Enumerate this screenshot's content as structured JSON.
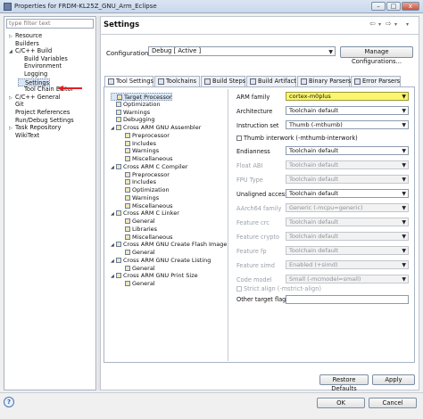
{
  "window": {
    "title": "Properties for FRDM-KL25Z_GNU_Arm_Eclipse",
    "minimize": "–",
    "maximize": "□",
    "close": "x"
  },
  "left": {
    "filter_placeholder": "type filter text",
    "items": [
      {
        "label": "Resource",
        "twisty": "▷",
        "indent": 0
      },
      {
        "label": "Builders",
        "twisty": "",
        "indent": 0
      },
      {
        "label": "C/C++ Build",
        "twisty": "◢",
        "indent": 0
      },
      {
        "label": "Build Variables",
        "twisty": "",
        "indent": 1
      },
      {
        "label": "Environment",
        "twisty": "",
        "indent": 1
      },
      {
        "label": "Logging",
        "twisty": "",
        "indent": 1
      },
      {
        "label": "Settings",
        "twisty": "",
        "indent": 1
      },
      {
        "label": "Tool Chain Editor",
        "twisty": "",
        "indent": 1
      },
      {
        "label": "C/C++ General",
        "twisty": "▷",
        "indent": 0
      },
      {
        "label": "Git",
        "twisty": "",
        "indent": 0
      },
      {
        "label": "Project References",
        "twisty": "",
        "indent": 0
      },
      {
        "label": "Run/Debug Settings",
        "twisty": "",
        "indent": 0
      },
      {
        "label": "Task Repository",
        "twisty": "▷",
        "indent": 0
      },
      {
        "label": "WikiText",
        "twisty": "",
        "indent": 0
      }
    ]
  },
  "header": {
    "title": "Settings",
    "back": "⇦",
    "back_menu": "▾",
    "forward": "⇨",
    "forward_menu": "▾",
    "view_menu": "▾"
  },
  "config": {
    "label": "Configuration:",
    "value": "Debug  [ Active ]",
    "manage_button": "Manage Configurations..."
  },
  "tabs": [
    {
      "label": "Tool Settings"
    },
    {
      "label": "Toolchains"
    },
    {
      "label": "Build Steps"
    },
    {
      "label": "Build Artifact"
    },
    {
      "label": "Binary Parsers"
    },
    {
      "label": "Error Parsers"
    }
  ],
  "tool_tree": [
    {
      "label": "Target Processor",
      "level": 0,
      "twisty": ""
    },
    {
      "label": "Optimization",
      "level": 0,
      "twisty": ""
    },
    {
      "label": "Warnings",
      "level": 0,
      "twisty": ""
    },
    {
      "label": "Debugging",
      "level": 0,
      "twisty": ""
    },
    {
      "label": "Cross ARM GNU Assembler",
      "level": 0,
      "twisty": "◢"
    },
    {
      "label": "Preprocessor",
      "level": 1,
      "twisty": ""
    },
    {
      "label": "Includes",
      "level": 1,
      "twisty": ""
    },
    {
      "label": "Warnings",
      "level": 1,
      "twisty": ""
    },
    {
      "label": "Miscellaneous",
      "level": 1,
      "twisty": ""
    },
    {
      "label": "Cross ARM C Compiler",
      "level": 0,
      "twisty": "◢"
    },
    {
      "label": "Preprocessor",
      "level": 1,
      "twisty": ""
    },
    {
      "label": "Includes",
      "level": 1,
      "twisty": ""
    },
    {
      "label": "Optimization",
      "level": 1,
      "twisty": ""
    },
    {
      "label": "Warnings",
      "level": 1,
      "twisty": ""
    },
    {
      "label": "Miscellaneous",
      "level": 1,
      "twisty": ""
    },
    {
      "label": "Cross ARM C Linker",
      "level": 0,
      "twisty": "◢"
    },
    {
      "label": "General",
      "level": 1,
      "twisty": ""
    },
    {
      "label": "Libraries",
      "level": 1,
      "twisty": ""
    },
    {
      "label": "Miscellaneous",
      "level": 1,
      "twisty": ""
    },
    {
      "label": "Cross ARM GNU Create Flash Image",
      "level": 0,
      "twisty": "◢"
    },
    {
      "label": "General",
      "level": 1,
      "twisty": ""
    },
    {
      "label": "Cross ARM GNU Create Listing",
      "level": 0,
      "twisty": "◢"
    },
    {
      "label": "General",
      "level": 1,
      "twisty": ""
    },
    {
      "label": "Cross ARM GNU Print Size",
      "level": 0,
      "twisty": "◢"
    },
    {
      "label": "General",
      "level": 1,
      "twisty": ""
    }
  ],
  "fields": {
    "arm_family": {
      "label": "ARM family",
      "value": "cortex-m0plus"
    },
    "architecture": {
      "label": "Architecture",
      "value": "Toolchain default"
    },
    "instruction_set": {
      "label": "Instruction set",
      "value": "Thumb (-mthumb)"
    },
    "thumb_interwork": {
      "label": "Thumb interwork (-mthumb-interwork)"
    },
    "endianness": {
      "label": "Endianness",
      "value": "Toolchain default"
    },
    "float_abi": {
      "label": "Float ABI",
      "value": "Toolchain default"
    },
    "fpu_type": {
      "label": "FPU Type",
      "value": "Toolchain default"
    },
    "unaligned_access": {
      "label": "Unaligned access",
      "value": "Toolchain default"
    },
    "aarch64_family": {
      "label": "AArch64 family",
      "value": "Generic (-mcpu=generic)"
    },
    "feature_crc": {
      "label": "Feature crc",
      "value": "Toolchain default"
    },
    "feature_crypto": {
      "label": "Feature crypto",
      "value": "Toolchain default"
    },
    "feature_fp": {
      "label": "Feature fp",
      "value": "Toolchain default"
    },
    "feature_simd": {
      "label": "Feature simd",
      "value": "Enabled (+simd)"
    },
    "code_model": {
      "label": "Code model",
      "value": "Small (-mcmodel=small)"
    },
    "strict_align": {
      "label": "Strict align (-mstrict-align)"
    },
    "other_flags": {
      "label": "Other target flags",
      "value": ""
    }
  },
  "buttons": {
    "restore": "Restore Defaults",
    "apply": "Apply",
    "ok": "OK",
    "cancel": "Cancel",
    "help": "?"
  },
  "colors": {
    "highlight": "#fbf66e",
    "annotation_arrow": "#e02020"
  }
}
